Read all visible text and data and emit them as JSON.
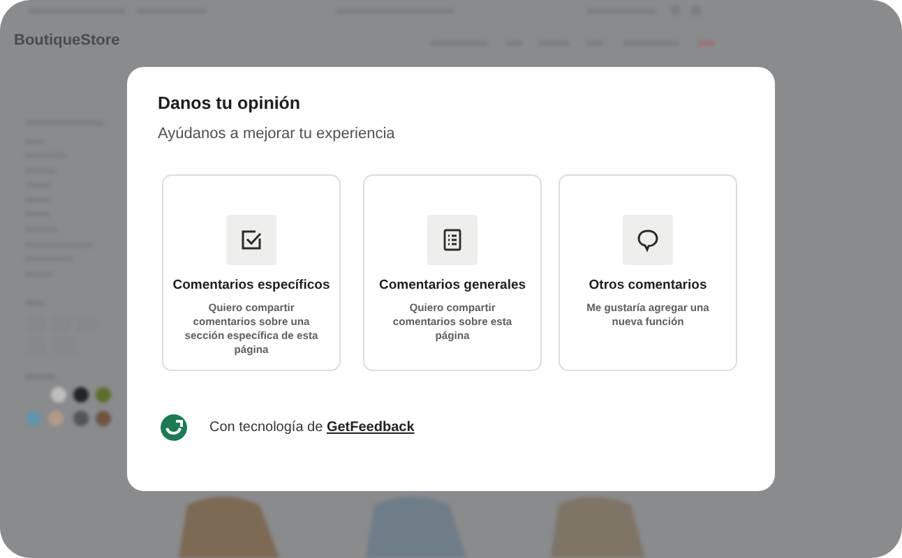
{
  "backdrop": {
    "brand": "BoutiqueStore"
  },
  "dialog": {
    "title": "Danos tu opinión",
    "subtitle": "Ayúdanos a mejorar tu experiencia",
    "options": [
      {
        "kind": "checkbox",
        "title": "Comentarios específicos",
        "description": "Quiero compartir comentarios sobre una sección específica de esta página"
      },
      {
        "kind": "list",
        "title": "Comentarios generales",
        "description": "Quiero compartir comentarios sobre esta página"
      },
      {
        "kind": "speech",
        "title": "Otros comentarios",
        "description": "Me gustaría agregar una nueva función"
      }
    ],
    "footer": {
      "prefix": "Con tecnología de",
      "link": "GetFeedback"
    }
  }
}
